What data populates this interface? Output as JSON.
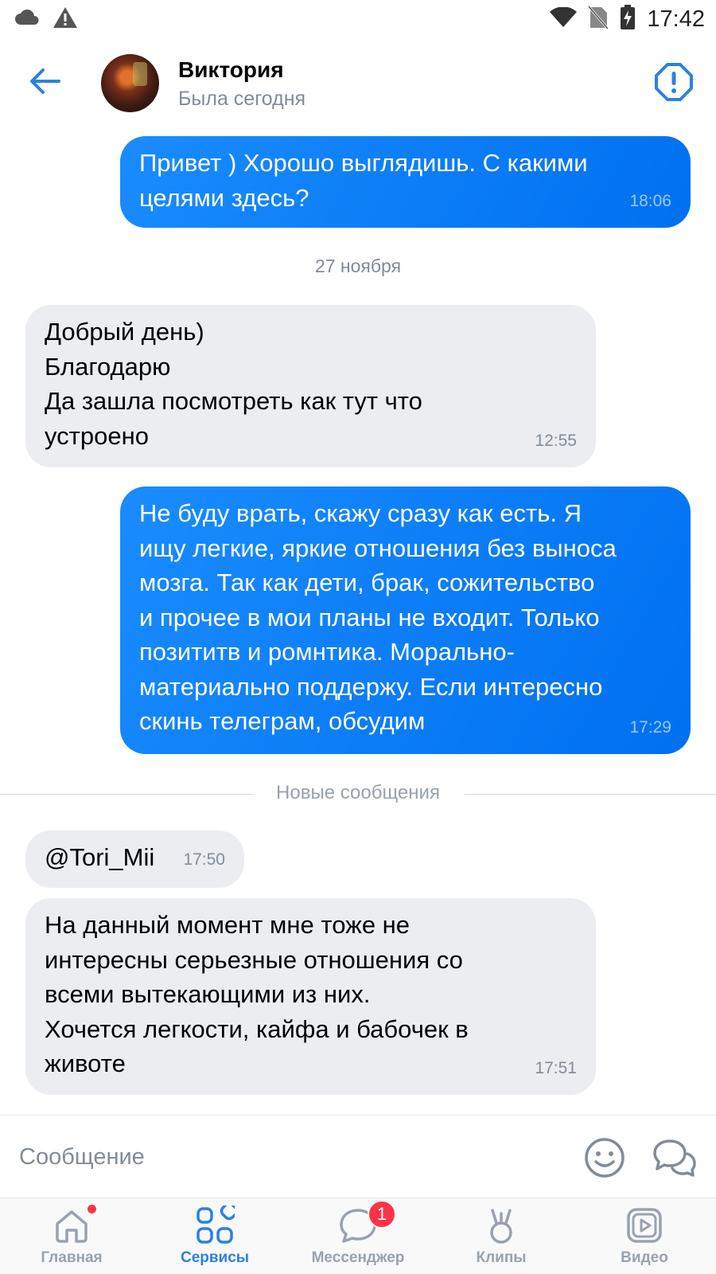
{
  "status_bar": {
    "time": "17:42",
    "icons": [
      "cloud-icon",
      "warning-icon",
      "wifi-icon",
      "no-sim-icon",
      "battery-charging-icon"
    ]
  },
  "header": {
    "contact_name": "Виктория",
    "contact_status": "Была сегодня"
  },
  "messages": [
    {
      "direction": "out",
      "text": "Привет ) Хорошо выглядишь. С какими\nцелями здесь?",
      "time": "18:06"
    },
    {
      "direction": "in",
      "text": "Добрый день)\nБлагодарю\nДа зашла посмотреть как тут что\nустроено",
      "time": "12:55"
    },
    {
      "direction": "out",
      "text": "Не буду врать, скажу сразу как есть. Я\nищу легкие, яркие отношения без выноса\nмозга. Так как дети, брак, сожительство\nи прочее в мои планы не входит. Только\nпозититв и ромнтика. Морально-\nматериально поддержу. Если интересно\nскинь телеграм, обсудим",
      "time": "17:29"
    },
    {
      "direction": "in",
      "text": "@Tori_Mii",
      "time": "17:50"
    },
    {
      "direction": "in",
      "text": "На данный момент мне тоже не\nинтересны серьезные отношения со\nвсеми вытекающими из них.\nХочется легкости, кайфа и бабочек в\nживоте",
      "time": "17:51"
    }
  ],
  "date_separator": "27 ноября",
  "new_messages_separator": "Новые сообщения",
  "composer": {
    "placeholder": "Сообщение"
  },
  "tabbar": {
    "tabs": [
      {
        "label": "Главная",
        "icon": "home-icon",
        "active": false,
        "dot": true
      },
      {
        "label": "Сервисы",
        "icon": "services-icon",
        "active": true
      },
      {
        "label": "Мессенджер",
        "icon": "messenger-icon",
        "active": false,
        "badge": "1"
      },
      {
        "label": "Клипы",
        "icon": "clips-icon",
        "active": false
      },
      {
        "label": "Видео",
        "icon": "video-icon",
        "active": false
      }
    ]
  },
  "colors": {
    "accent": "#2d81e0",
    "outgoing_bubble": "#0a7cf5",
    "incoming_bubble": "#ebedf0",
    "badge": "#ff3347"
  }
}
